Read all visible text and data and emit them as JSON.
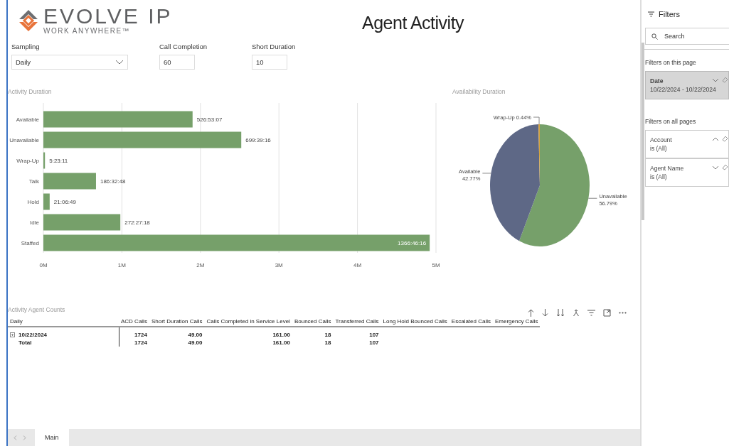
{
  "logo": {
    "name": "EVOLVE IP",
    "tagline": "WORK ANYWHERE™"
  },
  "title": "Agent Activity",
  "controls": [
    {
      "kind": "dropdown",
      "label": "Sampling",
      "value": "Daily"
    },
    {
      "kind": "input",
      "label": "Call Completion",
      "value": "60"
    },
    {
      "kind": "input",
      "label": "Short Duration",
      "value": "10"
    }
  ],
  "activity_chart": {
    "chart_data": {
      "type": "bar",
      "orientation": "horizontal",
      "title": "Activity Duration",
      "categories": [
        "Available",
        "Unavailable",
        "Wrap-Up",
        "Talk",
        "Hold",
        "Idle",
        "Staffed"
      ],
      "series": [
        {
          "color": "#76a06a",
          "values": [
            1.9,
            2.52,
            0.02,
            0.67,
            0.08,
            0.98,
            4.92
          ]
        }
      ],
      "grid": true,
      "xlim": [
        0,
        5
      ],
      "xticks": [
        {
          "value": 0,
          "label": "0M"
        },
        {
          "value": 1,
          "label": "1M"
        },
        {
          "value": 2,
          "label": "2M"
        },
        {
          "value": 3,
          "label": "3M"
        },
        {
          "value": 4,
          "label": "4M"
        },
        {
          "value": 5,
          "label": "5M"
        }
      ],
      "value_labels": [
        "526:53:07",
        "699:39:16",
        "5:23:11",
        "186:32:48",
        "21:06:49",
        "272:27:18",
        "1366:46:16"
      ]
    }
  },
  "availability_chart": {
    "chart_data": {
      "type": "pie",
      "title": "Availability Duration",
      "categories": [
        "Unavailable",
        "Available",
        "Wrap-Up"
      ],
      "series": [
        {
          "values": [
            56.79,
            42.77,
            0.44
          ]
        }
      ],
      "colors": [
        "#76a06a",
        "#5e6886",
        "#d8a33f"
      ],
      "value_labels": [
        "56.79%",
        "42.77%",
        "0.44%"
      ]
    }
  },
  "table": {
    "title": "Activity Agent Counts",
    "columns": [
      "Daily",
      "ACD Calls",
      "Short Duration Calls",
      "Calls Completed in Service Level",
      "Bounced Calls",
      "Transferred Calls",
      "Long Hold Bounced Calls",
      "Escalated Calls",
      "Emergency Calls"
    ],
    "rows": [
      {
        "kind": "group",
        "cells": [
          "10/22/2024",
          "1724",
          "49.00",
          "161.00",
          "18",
          "107"
        ]
      },
      {
        "kind": "total",
        "cells": [
          "Total",
          "1724",
          "49.00",
          "161.00",
          "18",
          "107"
        ]
      }
    ]
  },
  "page_tabs": [
    {
      "label": "Main",
      "selected": true
    }
  ],
  "filters": {
    "title": "Filters",
    "search_placeholder": "Search",
    "sections": [
      {
        "title": "Filters on this page",
        "cards": [
          {
            "name": "Date",
            "value": "10/22/2024 - 10/22/2024",
            "expanded": false,
            "applied": true
          }
        ]
      },
      {
        "title": "Filters on all pages",
        "cards": [
          {
            "name": "Account",
            "value": "is (All)",
            "expanded": true,
            "applied": false
          },
          {
            "name": "Agent Name",
            "value": "is (All)",
            "expanded": false,
            "applied": false
          }
        ]
      }
    ]
  }
}
